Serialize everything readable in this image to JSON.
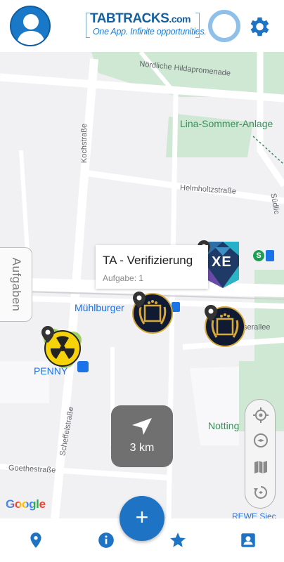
{
  "header": {
    "logo_brand": "TABTRACKS",
    "logo_domain": ".com",
    "logo_tagline": "One App. Infinite opportunities.",
    "icons": [
      "user-avatar-icon",
      "progress-ring-icon",
      "gear-icon"
    ]
  },
  "map": {
    "streets": {
      "hildapromenade": "Nördliche Hildapromenade",
      "kochstrasse": "Kochstraße",
      "lina_sommer": "Lina-Sommer-Anlage",
      "helmholtz": "Helmholtzstraße",
      "suedlich": "Südlic",
      "muehlburger": "Mühlburger",
      "penny": "PENNY",
      "seralle": "serallee",
      "scheffel": "Scheffelstraße",
      "goethe": "Goethestraße",
      "notting": "Notting",
      "rewe": "REWE Siec"
    },
    "aufgaben_tab": "Aufgaben",
    "tooltip": {
      "title": "TA - Verifizierung",
      "subtitle": "Aufgabe: 1"
    },
    "marker_xe_label": "XE",
    "distance": {
      "value": "3 km"
    },
    "controls": [
      "crosshair-icon",
      "compass-icon",
      "map-layers-icon",
      "rotate-reset-icon"
    ],
    "attribution": "Google"
  },
  "bottom_nav": {
    "items": [
      "location-pin-icon",
      "info-icon",
      "star-icon",
      "profile-card-icon"
    ],
    "fab_label": "+"
  },
  "colors": {
    "primary": "#1f73c5",
    "accent_ring": "#8fc0ea",
    "map_bg": "#f1f1f3",
    "park": "#cfe8d3",
    "road": "#ffffff"
  }
}
